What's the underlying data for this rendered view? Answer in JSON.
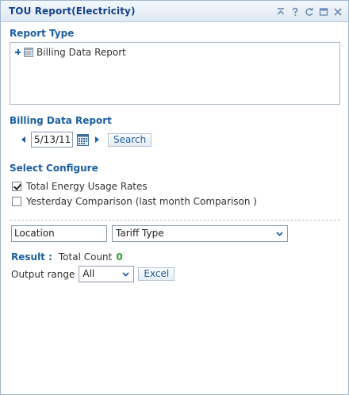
{
  "window": {
    "title": "TOU Report(Electricity)",
    "tools": [
      "collapse-icon",
      "help-icon",
      "refresh-icon",
      "maximize-icon",
      "close-icon"
    ]
  },
  "report_type": {
    "heading": "Report Type",
    "tree": [
      {
        "label": "Billing Data Report",
        "expander": "plus-icon",
        "icon": "document-icon"
      }
    ]
  },
  "billing": {
    "heading": "Billing Data Report",
    "date_value": "5/13/11",
    "search_label": "Search"
  },
  "configure": {
    "heading": "Select Configure",
    "options": [
      {
        "label": "Total Energy Usage Rates",
        "checked": true
      },
      {
        "label": "Yesterday Comparison (last month Comparison )",
        "checked": false
      }
    ]
  },
  "filters": {
    "location_value": "Location",
    "tariff_value": "Tariff Type"
  },
  "result": {
    "label": "Result :",
    "count_label": "Total Count",
    "count_value": "0"
  },
  "output": {
    "label": "Output range",
    "range_value": "All",
    "excel_label": "Excel"
  },
  "colors": {
    "accent": "#1c5fa0",
    "title": "#15428b",
    "count": "#2e9a2e",
    "border": "#9fb7cf"
  }
}
